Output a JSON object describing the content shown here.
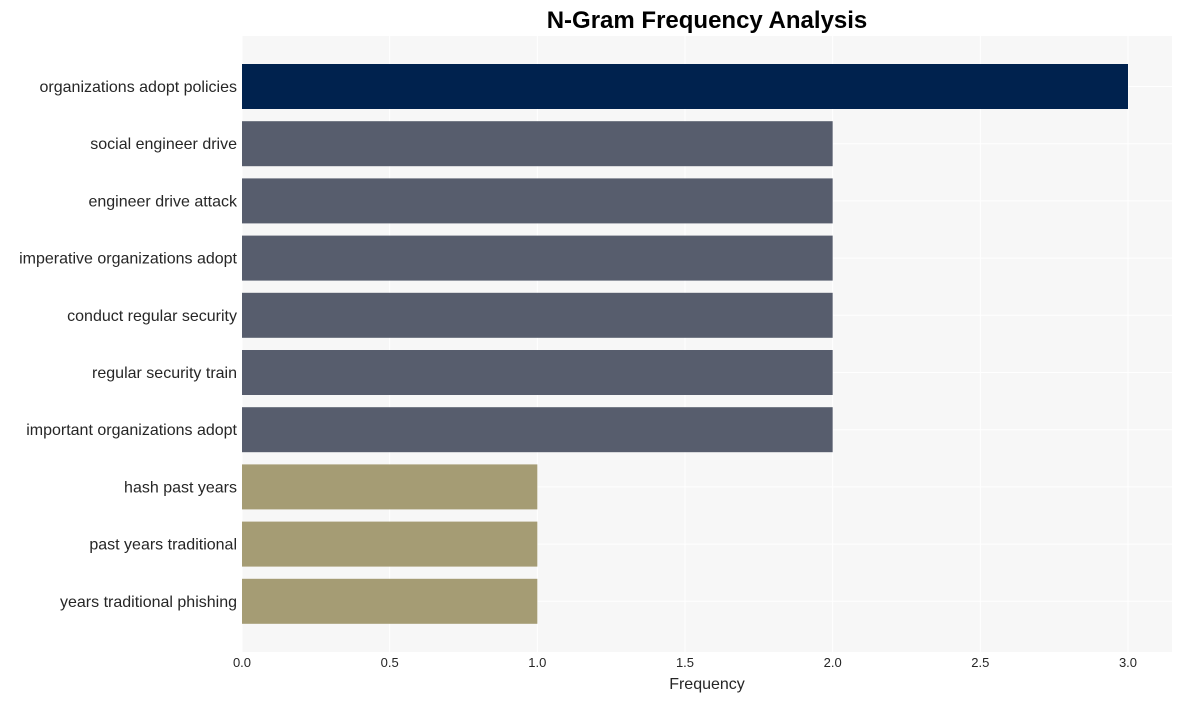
{
  "chart_data": {
    "type": "bar",
    "orientation": "horizontal",
    "title": "N-Gram Frequency Analysis",
    "xlabel": "Frequency",
    "ylabel": "",
    "xlim": [
      0,
      3.15
    ],
    "xticks": [
      0.0,
      0.5,
      1.0,
      1.5,
      2.0,
      2.5,
      3.0
    ],
    "xtick_labels": [
      "0.0",
      "0.5",
      "1.0",
      "1.5",
      "2.0",
      "2.5",
      "3.0"
    ],
    "grid": true,
    "categories": [
      "organizations adopt policies",
      "social engineer drive",
      "engineer drive attack",
      "imperative organizations adopt",
      "conduct regular security",
      "regular security train",
      "important organizations adopt",
      "hash past years",
      "past years traditional",
      "years traditional phishing"
    ],
    "values": [
      3,
      2,
      2,
      2,
      2,
      2,
      2,
      1,
      1,
      1
    ],
    "colors": [
      "#00224e",
      "#575d6d",
      "#575d6d",
      "#575d6d",
      "#575d6d",
      "#575d6d",
      "#575d6d",
      "#a59c74",
      "#a59c74",
      "#a59c74"
    ],
    "background": "#f7f7f7"
  }
}
